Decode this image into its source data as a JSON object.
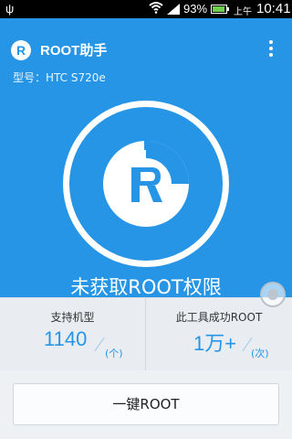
{
  "status_bar": {
    "usb_icon": "usb-icon",
    "wifi_icon": "wifi-icon",
    "signal_icon": "signal-icon",
    "battery_percent": "93%",
    "battery_level": 0.93,
    "ampm": "上午",
    "time": "10:41"
  },
  "header": {
    "logo_letter": "R",
    "title": "ROOT助手",
    "model_label": "型号：HTC S720e",
    "menu_icon": "more-vert-icon"
  },
  "hero": {
    "emblem_icon": "root-r-emblem-icon",
    "status": "未获取ROOT权限"
  },
  "stats": {
    "supported": {
      "label": "支持机型",
      "value": "1140",
      "unit": "(个)"
    },
    "success": {
      "label": "此工具成功ROOT",
      "value": "1万+",
      "unit": "(次)"
    }
  },
  "actions": {
    "root_button": "一键ROOT"
  },
  "colors": {
    "primary": "#2695e6",
    "status_bar": "#000000",
    "stats_bg": "#e9edf2",
    "button_bg": "#fbfcfd"
  }
}
